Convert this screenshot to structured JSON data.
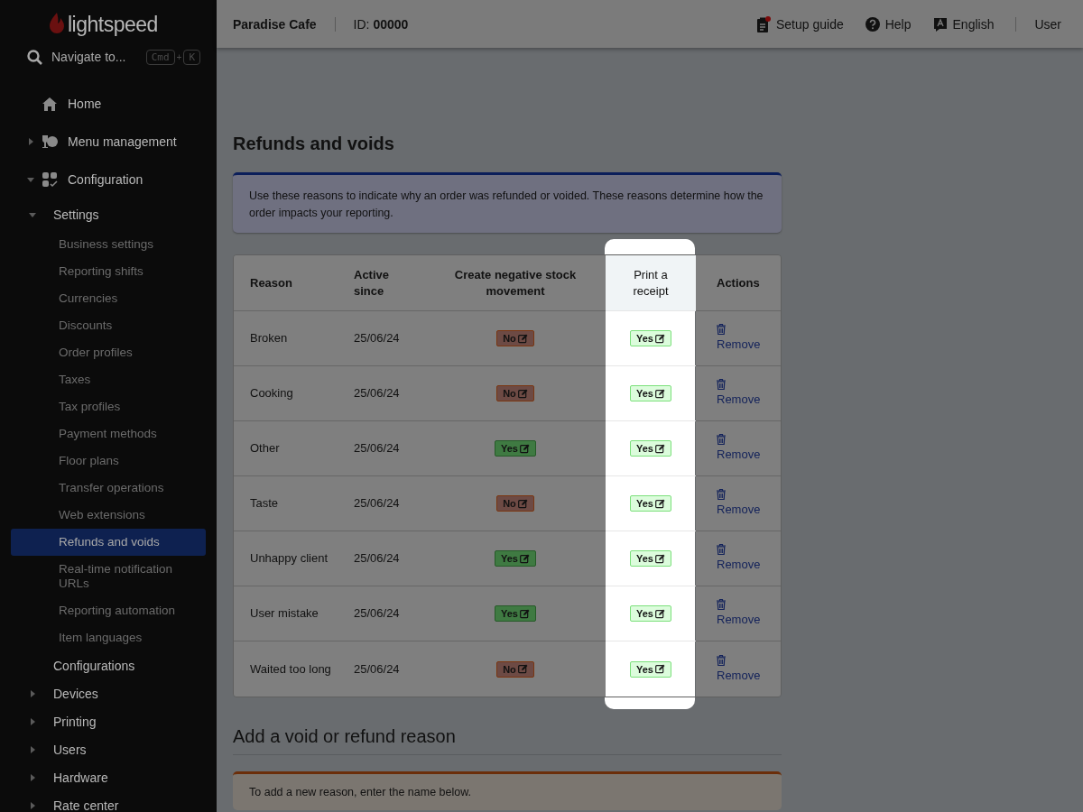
{
  "sidebar": {
    "logo": "lightspeed",
    "search": {
      "placeholder": "Navigate to...",
      "keys": [
        "Cmd",
        "+",
        "K"
      ]
    },
    "items": [
      {
        "label": "Home"
      },
      {
        "label": "Menu management",
        "expanded": false
      },
      {
        "label": "Configuration",
        "expanded": true,
        "children": [
          {
            "label": "Settings",
            "expanded": true,
            "children": [
              {
                "label": "Business settings",
                "selected": false
              },
              {
                "label": "Reporting shifts",
                "selected": false
              },
              {
                "label": "Currencies",
                "selected": false
              },
              {
                "label": "Discounts",
                "selected": false
              },
              {
                "label": "Order profiles",
                "selected": false
              },
              {
                "label": "Taxes",
                "selected": false
              },
              {
                "label": "Tax profiles",
                "selected": false
              },
              {
                "label": "Payment methods",
                "selected": false
              },
              {
                "label": "Floor plans",
                "selected": false
              },
              {
                "label": "Transfer operations",
                "selected": false
              },
              {
                "label": "Web extensions",
                "selected": false
              },
              {
                "label": "Refunds and voids",
                "selected": true
              },
              {
                "label": "Real-time notification URLs",
                "selected": false
              },
              {
                "label": "Reporting automation",
                "selected": false
              },
              {
                "label": "Item languages",
                "selected": false
              }
            ]
          },
          {
            "label": "Configurations"
          },
          {
            "label": "Devices",
            "expanded": false
          },
          {
            "label": "Printing",
            "expanded": false
          },
          {
            "label": "Users",
            "expanded": false
          },
          {
            "label": "Hardware",
            "expanded": false
          },
          {
            "label": "Rate center",
            "expanded": false
          }
        ]
      }
    ]
  },
  "topbar": {
    "venue": "Paradise Cafe",
    "id": "ID: **00000**",
    "setup_guide": "Setup guide",
    "help": "Help",
    "language": "English",
    "user": "User"
  },
  "title": "Refunds and voids",
  "info": "Use these reasons to indicate why an order was refunded or voided. These reasons determine how the order impacts your reporting.",
  "table": {
    "columns": [
      {
        "label": "Reason",
        "highlighted": false
      },
      {
        "label": "Active since",
        "highlighted": false
      },
      {
        "label": "Create negative stock movement",
        "highlighted": false
      },
      {
        "label": "Print a receipt",
        "highlighted": true
      },
      {
        "label": "Actions",
        "highlighted": false
      }
    ],
    "rows": [
      {
        "reason": "Broken",
        "active_since": "25/06/24",
        "negative_stock": {
          "value": "No",
          "on": false
        },
        "receipt": {
          "value": "Yes",
          "on": true
        },
        "action": "Remove"
      },
      {
        "reason": "Cooking",
        "active_since": "25/06/24",
        "negative_stock": {
          "value": "No",
          "on": false
        },
        "receipt": {
          "value": "Yes",
          "on": true
        },
        "action": "Remove"
      },
      {
        "reason": "Other",
        "active_since": "25/06/24",
        "negative_stock": {
          "value": "Yes",
          "on": true
        },
        "receipt": {
          "value": "Yes",
          "on": true
        },
        "action": "Remove"
      },
      {
        "reason": "Taste",
        "active_since": "25/06/24",
        "negative_stock": {
          "value": "No",
          "on": false
        },
        "receipt": {
          "value": "Yes",
          "on": true
        },
        "action": "Remove"
      },
      {
        "reason": "Unhappy client",
        "active_since": "25/06/24",
        "negative_stock": {
          "value": "Yes",
          "on": true
        },
        "receipt": {
          "value": "Yes",
          "on": true
        },
        "action": "Remove"
      },
      {
        "reason": "User mistake",
        "active_since": "25/06/24",
        "negative_stock": {
          "value": "Yes",
          "on": true
        },
        "receipt": {
          "value": "Yes",
          "on": true
        },
        "action": "Remove"
      },
      {
        "reason": "Waited too long",
        "active_since": "25/06/24",
        "negative_stock": {
          "value": "No",
          "on": false
        },
        "receipt": {
          "value": "Yes",
          "on": true
        },
        "action": "Remove"
      }
    ]
  },
  "add_section": {
    "title": "Add a void or refund reason",
    "info": "To add a new reason, enter the name below."
  }
}
